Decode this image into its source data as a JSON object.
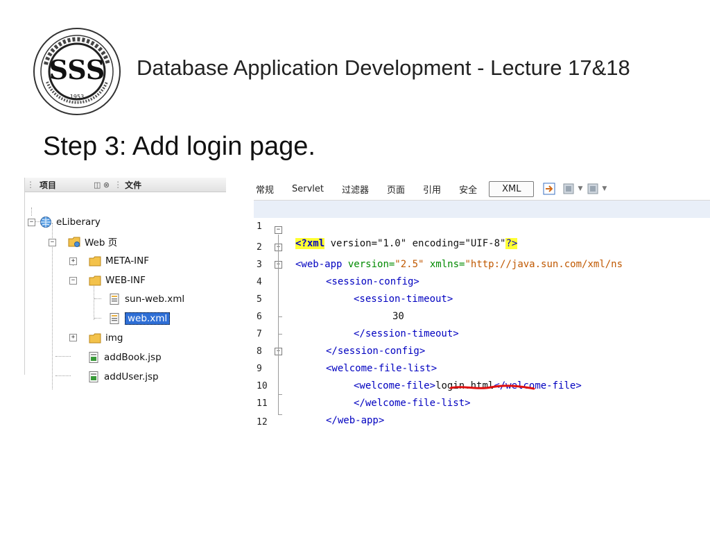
{
  "header": {
    "title": "Database Application Development - Lecture 17&18"
  },
  "logo": {
    "year": "1953",
    "arc_text": "浙江水利水电专科学校"
  },
  "slide": {
    "heading": "Step 3: Add login page."
  },
  "project_tree": {
    "tab_projects": "项目",
    "tab_files": "文件",
    "mini_controls": "◫ ⊗",
    "nodes": [
      {
        "label": "eLiberary",
        "icon": "globe-project-icon",
        "expanded": true
      },
      {
        "label": "Web 页",
        "icon": "web-folder-icon",
        "expanded": true
      },
      {
        "label": "META-INF",
        "icon": "folder-icon",
        "expanded": false
      },
      {
        "label": "WEB-INF",
        "icon": "folder-icon",
        "expanded": true
      },
      {
        "label": "sun-web.xml",
        "icon": "xml-file-icon"
      },
      {
        "label": "web.xml",
        "icon": "xml-file-icon",
        "selected": true
      },
      {
        "label": "img",
        "icon": "folder-icon",
        "expanded": false
      },
      {
        "label": "addBook.jsp",
        "icon": "jsp-file-icon"
      },
      {
        "label": "addUser.jsp",
        "icon": "jsp-file-icon"
      }
    ]
  },
  "editor": {
    "tabs": [
      "常规",
      "Servlet",
      "过滤器",
      "页面",
      "引用",
      "安全",
      "XML"
    ],
    "active_tab": "XML",
    "toolbar_icons": [
      "history-icon",
      "nav-back-icon",
      "nav-forward-icon"
    ],
    "lines": [
      {
        "num": "1"
      },
      {
        "num": "2"
      },
      {
        "num": "3"
      },
      {
        "num": "4"
      },
      {
        "num": "5"
      },
      {
        "num": "6"
      },
      {
        "num": "7"
      },
      {
        "num": "8"
      },
      {
        "num": "9"
      },
      {
        "num": "10"
      },
      {
        "num": "11"
      },
      {
        "num": "12"
      }
    ],
    "code": {
      "l1_pi_open": "<?",
      "l1_pi_name": "xml",
      "l1_attrs": " version=\"1.0\" encoding=\"UIF-8\"",
      "l1_pi_close": "?>",
      "l2_tag": "<web-app",
      "l2_a1": " version=",
      "l2_v1": "\"2.5\"",
      "l2_a2": " xmlns=",
      "l2_v2": "\"http://java.sun.com/xml/ns",
      "l3": "<session-config>",
      "l4": "<session-timeout>",
      "l5": "30",
      "l6": "</session-timeout>",
      "l7": "</session-config>",
      "l8": "<welcome-file-list>",
      "l9_open": "<welcome-file>",
      "l9_text": "login.html",
      "l9_close": "</welcome-file>",
      "l10": "</welcome-file-list>",
      "l11": "</web-app>"
    }
  },
  "annotation": {
    "underline_color": "#e01010"
  }
}
